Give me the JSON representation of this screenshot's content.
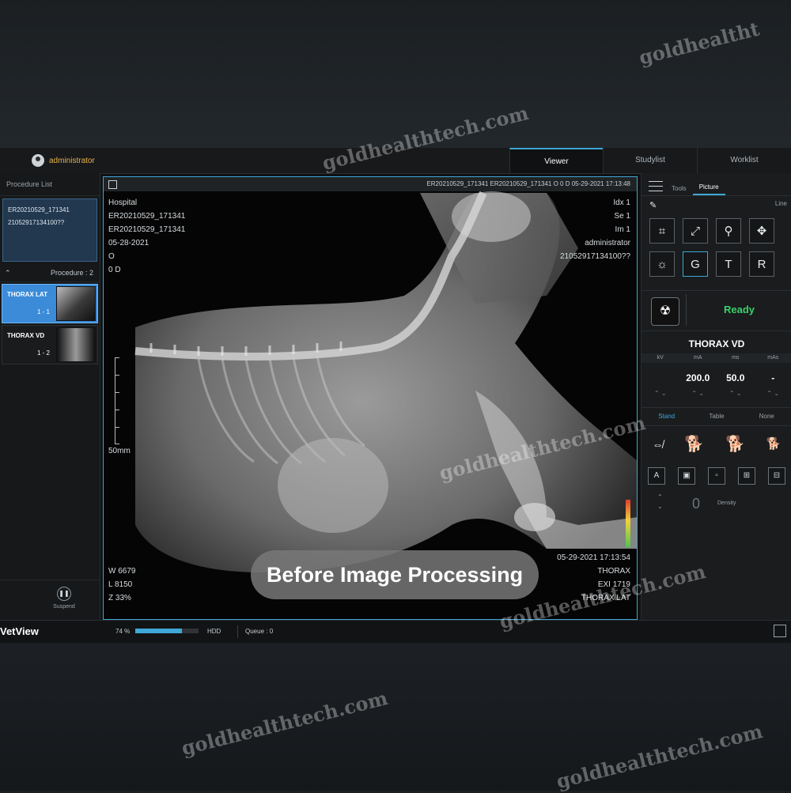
{
  "topbar": {
    "user": "administrator",
    "tabs": [
      "Viewer",
      "Studylist",
      "Worklist"
    ],
    "active_tab": "Viewer"
  },
  "left_panel": {
    "header": "Procedure List",
    "patient": {
      "id": "ER20210529_171341",
      "sub_id": "21052917134100??"
    },
    "procedure_count_label": "Procedure : 2",
    "procedures": [
      {
        "label": "THORAX LAT",
        "count": "1 - 1",
        "selected": true
      },
      {
        "label": "THORAX VD",
        "count": "1 - 2",
        "selected": false
      }
    ],
    "suspend_label": "Suspend"
  },
  "viewer": {
    "info_bar": "ER20210529_171341   ER20210529_171341   O  0 D   05-29-2021  17:13:48",
    "top_left": [
      "Hospital",
      "ER20210529_171341",
      "ER20210529_171341",
      "05-28-2021",
      "O",
      "0 D"
    ],
    "top_right": [
      "Idx 1",
      "Se 1",
      "Im 1",
      "administrator",
      "21052917134100??"
    ],
    "bottom_left": [
      "W 6679",
      "L 8150",
      "Z 33%"
    ],
    "bottom_right": [
      "05-29-2021 17:13:54",
      "THORAX",
      "EXI 1719",
      "THORAX LAT"
    ],
    "scale_label": "50mm",
    "caption": "Before Image Processing"
  },
  "right_panel": {
    "tabs": [
      "Tools",
      "Picture"
    ],
    "line_label": "Line",
    "tools_row1": [
      "crop-icon",
      "fit-icon",
      "zoom-icon",
      "move-icon"
    ],
    "tools_row2": [
      "brightness-icon",
      "g-icon",
      "text-icon",
      "rotate-icon"
    ],
    "status": "Ready",
    "procedure_title": "THORAX VD",
    "param_headers": [
      "kV",
      "mA",
      "ms",
      "mAs"
    ],
    "param_values": [
      "",
      "200.0",
      "50.0",
      "-"
    ],
    "sub_tabs": [
      "Stand",
      "Table",
      "None"
    ],
    "density_value": "0",
    "density_label": "Density"
  },
  "statusbar": {
    "brand": "VetView",
    "percent": "74 %",
    "hdd_label": "HDD",
    "hdd_fill": 0.74,
    "queue": "Queue : 0"
  },
  "watermark": "goldhealthtech.com",
  "watermark_short": "goldhealtht",
  "colors": {
    "accent": "#3fa7d6",
    "ready": "#38d26a",
    "user": "#e8b24a"
  }
}
